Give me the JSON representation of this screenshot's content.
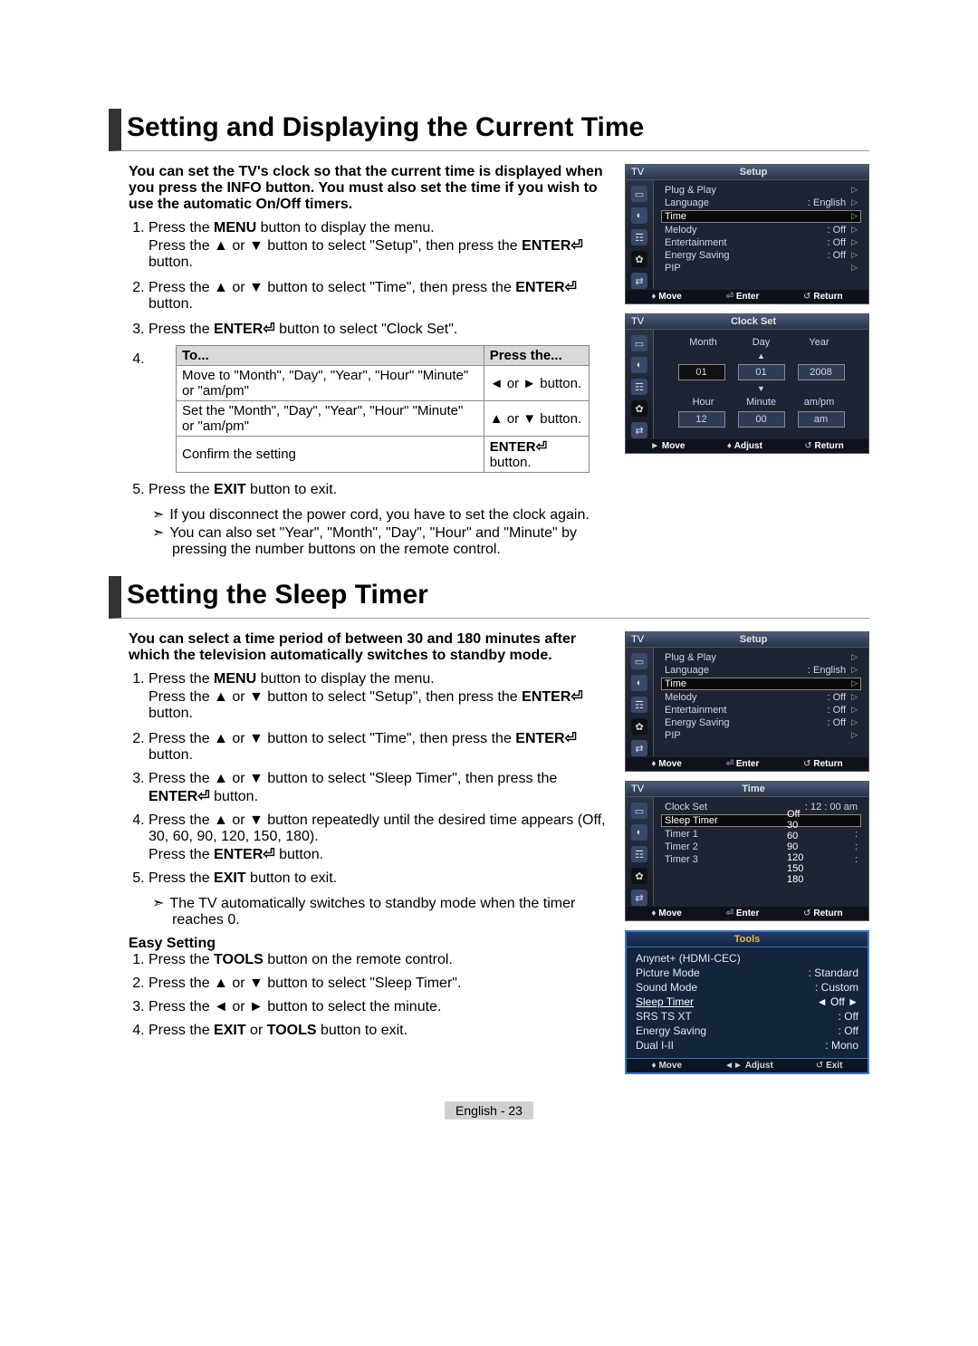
{
  "section1": {
    "title": "Setting and Displaying the Current Time",
    "intro": "You can set the TV's clock so that the current time is displayed when you press the INFO button. You must also set the time if you wish to use the automatic On/Off timers.",
    "step1a": "Press the ",
    "step1b": " button to display the menu.",
    "step1c": "Press the ▲ or ▼ button to select \"Setup\", then press the ",
    "step1d": " button.",
    "step2a": "Press the ▲ or ▼ button to select \"Time\", then press the ",
    "step2b": " button.",
    "step3a": "Press the ",
    "step3b": " button to select \"Clock Set\".",
    "step4label": "4.",
    "table": {
      "h1": "To...",
      "h2": "Press the...",
      "r1c1": "Move to \"Month\", \"Day\", \"Year\", \"Hour\" \"Minute\" or \"am/pm\"",
      "r1c2": "◄ or ► button.",
      "r2c1": "Set the \"Month\", \"Day\", \"Year\", \"Hour\" \"Minute\" or \"am/pm\"",
      "r2c2": "▲ or ▼ button.",
      "r3c1": "Confirm the setting",
      "r3c2a": "ENTER",
      "r3c2b": " button."
    },
    "step5a": "Press the ",
    "step5b": " button to exit.",
    "note1": "If you disconnect the power cord, you have to set the clock again.",
    "note2": "You can also set \"Year\", \"Month\", \"Day\", \"Hour\" and \"Minute\" by pressing the number buttons on the remote control."
  },
  "section2": {
    "title": "Setting the Sleep Timer",
    "intro": "You can select a time period of between 30 and 180 minutes after which the television automatically switches to standby mode.",
    "step1a": "Press the ",
    "step1b": " button to display the menu.",
    "step1c": "Press the ▲ or ▼ button to select \"Setup\", then press the ",
    "step1d": " button.",
    "step2a": "Press the ▲ or ▼ button to select \"Time\", then press the ",
    "step2b": " button.",
    "step3a": "Press the ▲ or ▼ button to select \"Sleep Timer\", then press the ",
    "step3b": " button.",
    "step4a": "Press the ▲ or ▼ button repeatedly until the desired time appears (Off, 30, 60, 90, 120, 150, 180).",
    "step4b": "Press the ",
    "step4c": " button.",
    "step5a": "Press the ",
    "step5b": " button to exit.",
    "note1": "The TV automatically switches to standby mode when the timer reaches 0.",
    "easyTitle": "Easy Setting",
    "e1a": "Press the ",
    "e1b": " button on the remote control.",
    "e2": "Press the ▲ or ▼ button to select \"Sleep Timer\".",
    "e3": "Press the ◄ or ► button to select the minute.",
    "e4a": "Press the ",
    "e4b": " or ",
    "e4c": " button to exit."
  },
  "osd_setup1": {
    "tv": "TV",
    "title": "Setup",
    "items": [
      {
        "l": "Plug & Play",
        "v": ""
      },
      {
        "l": "Language",
        "v": ": English"
      },
      {
        "l": "Time",
        "v": "",
        "hl": true
      },
      {
        "l": "Melody",
        "v": ": Off"
      },
      {
        "l": "Entertainment",
        "v": ": Off"
      },
      {
        "l": "Energy Saving",
        "v": ": Off"
      },
      {
        "l": "PIP",
        "v": "",
        "dim": true
      }
    ],
    "foot": {
      "m": "Move",
      "e": "Enter",
      "r": "Return"
    }
  },
  "osd_clockset": {
    "tv": "TV",
    "title": "Clock Set",
    "labels1": [
      "Month",
      "Day",
      "Year"
    ],
    "vals1": [
      "01",
      "01",
      "2008"
    ],
    "labels2": [
      "Hour",
      "Minute",
      "am/pm"
    ],
    "vals2": [
      "12",
      "00",
      "am"
    ],
    "foot": {
      "m": "Move",
      "a": "Adjust",
      "r": "Return"
    }
  },
  "osd_setup2": {
    "tv": "TV",
    "title": "Setup",
    "items": [
      {
        "l": "Plug & Play",
        "v": ""
      },
      {
        "l": "Language",
        "v": ": English"
      },
      {
        "l": "Time",
        "v": "",
        "hl": true
      },
      {
        "l": "Melody",
        "v": ": Off"
      },
      {
        "l": "Entertainment",
        "v": ": Off"
      },
      {
        "l": "Energy Saving",
        "v": ": Off"
      },
      {
        "l": "PIP",
        "v": "",
        "dim": true
      }
    ],
    "foot": {
      "m": "Move",
      "e": "Enter",
      "r": "Return"
    }
  },
  "osd_time": {
    "tv": "TV",
    "title": "Time",
    "rows": [
      {
        "l": "Clock Set",
        "v": ": 12 : 00   am"
      },
      {
        "l": "Sleep Timer",
        "v": "",
        "hl": true
      }
    ],
    "dimrows": [
      "Timer 1",
      "Timer 2",
      "Timer 3"
    ],
    "options": [
      "Off",
      "30",
      "60",
      "90",
      "120",
      "150",
      "180"
    ],
    "optSel": 0,
    "foot": {
      "m": "Move",
      "e": "Enter",
      "r": "Return"
    }
  },
  "osd_tools": {
    "title": "Tools",
    "rows": [
      {
        "l": "Anynet+ (HDMI-CEC)",
        "v": ""
      },
      {
        "l": "Picture Mode",
        "v": "Standard"
      },
      {
        "l": "Sound Mode",
        "v": "Custom"
      },
      {
        "l": "Sleep Timer",
        "v": "Off",
        "hl": true
      },
      {
        "l": "SRS TS XT",
        "v": "Off"
      },
      {
        "l": "Energy Saving",
        "v": "Off"
      },
      {
        "l": "Dual I-II",
        "v": "Mono"
      }
    ],
    "foot": {
      "m": "Move",
      "a": "Adjust",
      "e": "Exit"
    }
  },
  "keywords": {
    "MENU": "MENU",
    "ENTER": "ENTER",
    "EXIT": "EXIT",
    "TOOLS": "TOOLS",
    "enterGlyph": "⏎"
  },
  "pageFoot": "English - 23"
}
